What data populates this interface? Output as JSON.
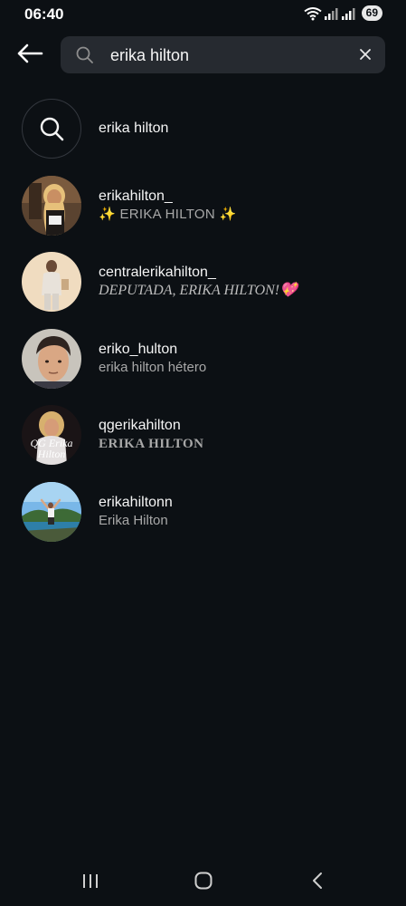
{
  "status_bar": {
    "time": "06:40",
    "battery": "69"
  },
  "search": {
    "query": "erika hilton"
  },
  "results": [
    {
      "type": "query",
      "title": "erika hilton",
      "icon": "search-icon"
    },
    {
      "type": "account",
      "username": "erikahilton_",
      "subtitle": "✨ ERIKA HILTON ✨"
    },
    {
      "type": "account",
      "username": "centralerikahilton_",
      "subtitle": "DEPUTADA, ERIKA HILTON!💖"
    },
    {
      "type": "account",
      "username": "eriko_hulton",
      "subtitle": "erika hilton hétero"
    },
    {
      "type": "account",
      "username": "qgerikahilton",
      "subtitle": "ERIKA HILTON"
    },
    {
      "type": "account",
      "username": "erikahiltonn",
      "subtitle": "Erika Hilton"
    }
  ],
  "colors": {
    "background": "#0c1014",
    "search_field": "#262a30",
    "primary_text": "#f5f5f5",
    "secondary_text": "#a8a8a8"
  }
}
